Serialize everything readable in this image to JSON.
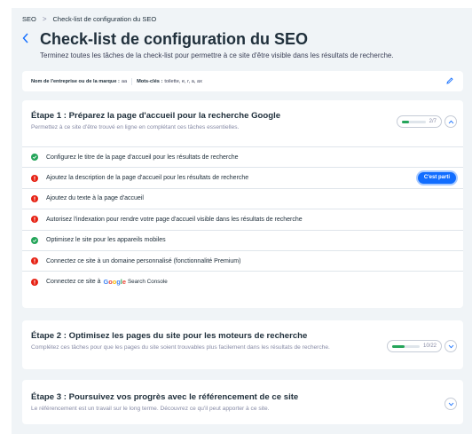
{
  "breadcrumb": {
    "root": "SEO",
    "separator": ">",
    "current": "Check-list de configuration du SEO"
  },
  "header": {
    "title": "Check-list de configuration du SEO",
    "subtitle": "Terminez toutes les tâches de la check-list pour permettre à ce site d'être visible dans les résultats de recherche."
  },
  "business": {
    "name_label": "Nom de l'entreprise ou de la marque :",
    "name_value": "aa",
    "keywords_label": "Mots-clés :",
    "keywords_value": "toilette, e, r, a, ax"
  },
  "steps": [
    {
      "title": "Étape 1 : Préparez la page d'accueil pour la recherche Google",
      "description": "Permettez à ce site d'être trouvé en ligne en complétant ces tâches essentielles.",
      "progress_text": "2/7",
      "progress_fraction": 0.2857,
      "expanded": true,
      "tasks": [
        {
          "label": "Configurez le titre de la page d'accueil pour les résultats de recherche",
          "status": "done"
        },
        {
          "label": "Ajoutez la description de la page d'accueil pour les résultats de recherche",
          "status": "todo",
          "action": "C'est parti"
        },
        {
          "label": "Ajoutez du texte à la page d'accueil",
          "status": "todo"
        },
        {
          "label": "Autorisez l'indexation pour rendre votre page d'accueil visible dans les résultats de recherche",
          "status": "todo"
        },
        {
          "label": "Optimisez le site pour les appareils mobiles",
          "status": "done"
        },
        {
          "label": "Connectez ce site à un domaine personnalisé (fonctionnalité Premium)",
          "status": "todo"
        },
        {
          "label": "Connectez ce site à",
          "status": "todo",
          "brand": "Google",
          "brand_suffix": "Search Console"
        }
      ]
    },
    {
      "title": "Étape 2 : Optimisez les pages du site pour les moteurs de recherche",
      "description": "Complétez ces tâches pour que les pages du site soient trouvables plus facilement dans les résultats de recherche.",
      "progress_text": "10/22",
      "progress_fraction": 0.4545,
      "expanded": false
    },
    {
      "title": "Étape 3 : Poursuivez vos progrès avec le référencement de ce site",
      "description": "Le référencement est un travail sur le long terme. Découvrez ce qu'il peut apporter à ce site.",
      "expanded": false
    }
  ],
  "colors": {
    "accent": "#116dff",
    "success": "#25a55a",
    "error": "#e62214",
    "background": "#f0f4f7"
  }
}
